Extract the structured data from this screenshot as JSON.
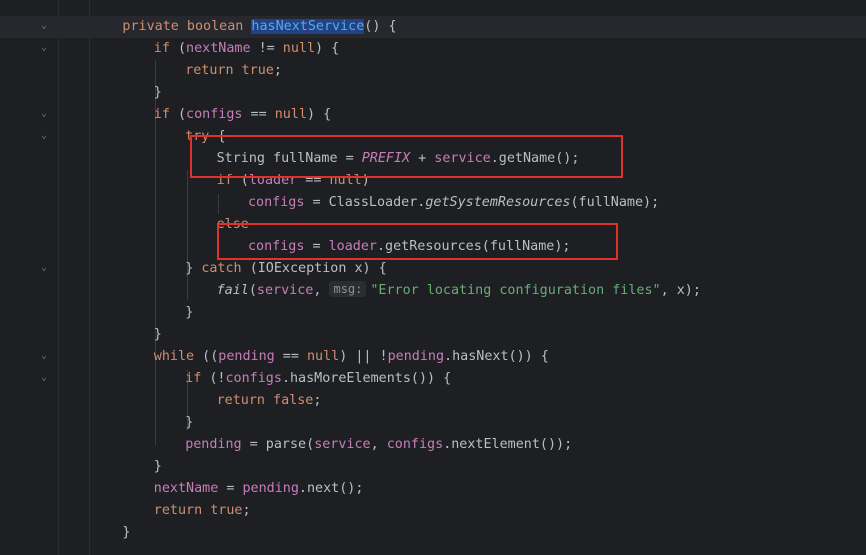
{
  "editor": {
    "lines": [
      {
        "indent": 1,
        "tokens": [
          {
            "t": "private boolean ",
            "c": "kw"
          },
          {
            "t": "hasNextService",
            "c": "fn hl"
          },
          {
            "t": "() {",
            "c": ""
          }
        ]
      },
      {
        "indent": 2,
        "tokens": [
          {
            "t": "if ",
            "c": "kw"
          },
          {
            "t": "(",
            "c": ""
          },
          {
            "t": "nextName",
            "c": "fld"
          },
          {
            "t": " != ",
            "c": ""
          },
          {
            "t": "null",
            "c": "kw"
          },
          {
            "t": ") {",
            "c": ""
          }
        ]
      },
      {
        "indent": 3,
        "tokens": [
          {
            "t": "return true",
            "c": "kw"
          },
          {
            "t": ";",
            "c": ""
          }
        ]
      },
      {
        "indent": 2,
        "tokens": [
          {
            "t": "}",
            "c": ""
          }
        ]
      },
      {
        "indent": 2,
        "tokens": [
          {
            "t": "if ",
            "c": "kw"
          },
          {
            "t": "(",
            "c": ""
          },
          {
            "t": "configs",
            "c": "fld"
          },
          {
            "t": " == ",
            "c": ""
          },
          {
            "t": "null",
            "c": "kw"
          },
          {
            "t": ") {",
            "c": ""
          }
        ]
      },
      {
        "indent": 3,
        "tokens": [
          {
            "t": "try ",
            "c": "kw"
          },
          {
            "t": "{",
            "c": ""
          }
        ]
      },
      {
        "indent": 4,
        "tokens": [
          {
            "t": "String fullName = ",
            "c": ""
          },
          {
            "t": "PREFIX",
            "c": "cst"
          },
          {
            "t": " + ",
            "c": ""
          },
          {
            "t": "service",
            "c": "fld"
          },
          {
            "t": ".getName();",
            "c": ""
          }
        ]
      },
      {
        "indent": 4,
        "tokens": [
          {
            "t": "if ",
            "c": "kw"
          },
          {
            "t": "(",
            "c": ""
          },
          {
            "t": "loader",
            "c": "fld"
          },
          {
            "t": " == ",
            "c": ""
          },
          {
            "t": "null",
            "c": "kw"
          },
          {
            "t": ")",
            "c": ""
          }
        ]
      },
      {
        "indent": 5,
        "tokens": [
          {
            "t": "configs",
            "c": "fld"
          },
          {
            "t": " = ClassLoader.",
            "c": ""
          },
          {
            "t": "getSystemResources",
            "c": "it"
          },
          {
            "t": "(fullName);",
            "c": ""
          }
        ]
      },
      {
        "indent": 4,
        "tokens": [
          {
            "t": "else",
            "c": "kw"
          }
        ]
      },
      {
        "indent": 5,
        "tokens": [
          {
            "t": "configs",
            "c": "fld"
          },
          {
            "t": " = ",
            "c": ""
          },
          {
            "t": "loader",
            "c": "fld"
          },
          {
            "t": ".getResources(fullName);",
            "c": ""
          }
        ]
      },
      {
        "indent": 3,
        "tokens": [
          {
            "t": "} ",
            "c": ""
          },
          {
            "t": "catch ",
            "c": "kw"
          },
          {
            "t": "(IOException x) {",
            "c": ""
          }
        ]
      },
      {
        "indent": 4,
        "tokens": [
          {
            "t": "fail",
            "c": "it"
          },
          {
            "t": "(",
            "c": ""
          },
          {
            "t": "service",
            "c": "fld"
          },
          {
            "t": ", ",
            "c": ""
          },
          {
            "t": "msg:",
            "c": "hint"
          },
          {
            "t": "\"Error locating configuration files\"",
            "c": "str"
          },
          {
            "t": ", x);",
            "c": ""
          }
        ]
      },
      {
        "indent": 3,
        "tokens": [
          {
            "t": "}",
            "c": ""
          }
        ]
      },
      {
        "indent": 2,
        "tokens": [
          {
            "t": "}",
            "c": ""
          }
        ]
      },
      {
        "indent": 2,
        "tokens": [
          {
            "t": "while ",
            "c": "kw"
          },
          {
            "t": "((",
            "c": ""
          },
          {
            "t": "pending",
            "c": "fld"
          },
          {
            "t": " == ",
            "c": ""
          },
          {
            "t": "null",
            "c": "kw"
          },
          {
            "t": ") || !",
            "c": ""
          },
          {
            "t": "pending",
            "c": "fld"
          },
          {
            "t": ".hasNext()) {",
            "c": ""
          }
        ]
      },
      {
        "indent": 3,
        "tokens": [
          {
            "t": "if ",
            "c": "kw"
          },
          {
            "t": "(!",
            "c": ""
          },
          {
            "t": "configs",
            "c": "fld"
          },
          {
            "t": ".hasMoreElements()) {",
            "c": ""
          }
        ]
      },
      {
        "indent": 4,
        "tokens": [
          {
            "t": "return false",
            "c": "kw"
          },
          {
            "t": ";",
            "c": ""
          }
        ]
      },
      {
        "indent": 3,
        "tokens": [
          {
            "t": "}",
            "c": ""
          }
        ]
      },
      {
        "indent": 3,
        "tokens": [
          {
            "t": "pending",
            "c": "fld"
          },
          {
            "t": " = parse(",
            "c": ""
          },
          {
            "t": "service",
            "c": "fld"
          },
          {
            "t": ", ",
            "c": ""
          },
          {
            "t": "configs",
            "c": "fld"
          },
          {
            "t": ".nextElement());",
            "c": ""
          }
        ]
      },
      {
        "indent": 2,
        "tokens": [
          {
            "t": "}",
            "c": ""
          }
        ]
      },
      {
        "indent": 2,
        "tokens": [
          {
            "t": "nextName",
            "c": "fld"
          },
          {
            "t": " = ",
            "c": ""
          },
          {
            "t": "pending",
            "c": "fld"
          },
          {
            "t": ".next();",
            "c": ""
          }
        ]
      },
      {
        "indent": 2,
        "tokens": [
          {
            "t": "return true",
            "c": "kw"
          },
          {
            "t": ";",
            "c": ""
          }
        ]
      },
      {
        "indent": 1,
        "tokens": [
          {
            "t": "}",
            "c": ""
          }
        ]
      }
    ],
    "fold_markers": [
      {
        "line": 0,
        "icon": "fold-open-icon",
        "glyph": "⌄"
      },
      {
        "line": 1,
        "icon": "fold-open-icon",
        "glyph": "⌄"
      },
      {
        "line": 4,
        "icon": "fold-open-icon",
        "glyph": "⌄"
      },
      {
        "line": 5,
        "icon": "fold-open-icon",
        "glyph": "⌄"
      },
      {
        "line": 11,
        "icon": "fold-open-icon",
        "glyph": "⌄"
      },
      {
        "line": 15,
        "icon": "fold-open-icon",
        "glyph": "⌄"
      },
      {
        "line": 16,
        "icon": "fold-open-icon",
        "glyph": "⌄"
      }
    ],
    "colors": {
      "background": "#1e1f22",
      "keyword": "#cf8e6d",
      "field": "#c77dbb",
      "string": "#6aab73",
      "method_decl": "#56a8f5",
      "annotation_box": "#e0322b"
    }
  },
  "annotations": [
    {
      "name": "highlight-box-fullname"
    },
    {
      "name": "highlight-box-getresources"
    }
  ]
}
